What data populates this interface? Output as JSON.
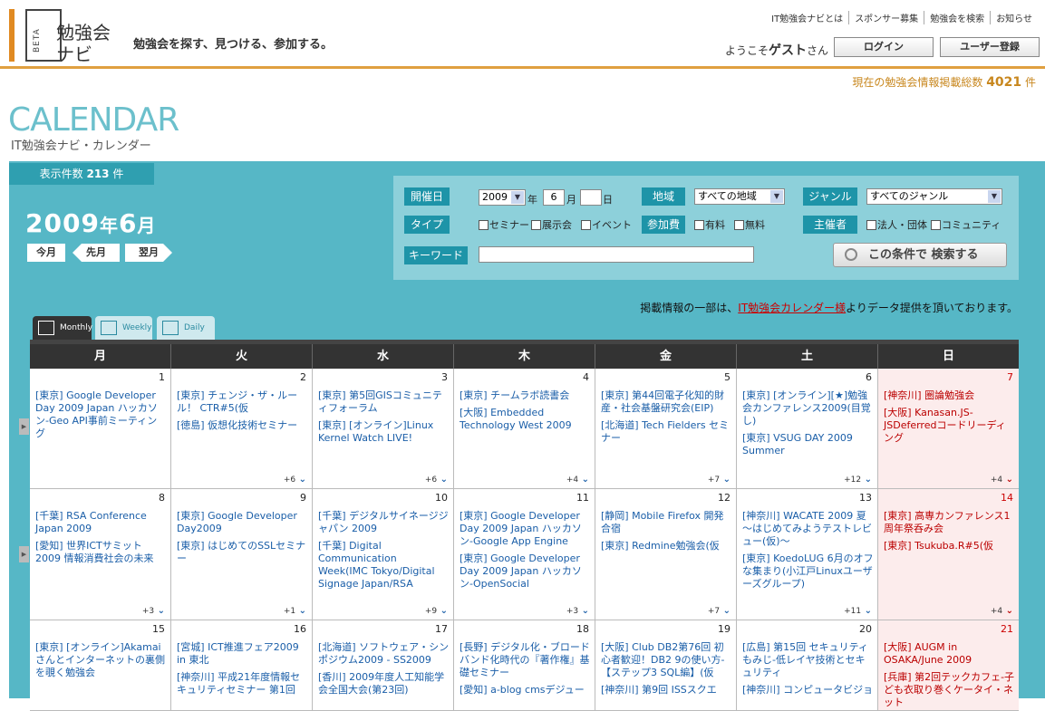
{
  "header": {
    "logo_beta": "BETA",
    "logo_name_1": "勉強会",
    "logo_name_2": "ナビ",
    "tagline": "勉強会を探す、見つける、参加する。",
    "nav": [
      "IT勉強会ナビとは",
      "スポンサー募集",
      "勉強会を検索",
      "お知らせ"
    ],
    "welcome_prefix": "ようこそ",
    "welcome_user": "ゲスト",
    "welcome_suffix": "さん",
    "login_label": "ログイン",
    "register_label": "ユーザー登録",
    "total_prefix": "現在の勉強会情報掲載総数",
    "total_count": "4021",
    "total_suffix": "件"
  },
  "title": {
    "main": "CALENDAR",
    "sub": "IT勉強会ナビ・カレンダー"
  },
  "count": {
    "prefix": "表示件数",
    "value": "213",
    "suffix": "件"
  },
  "current_month": {
    "year": "2009",
    "year_unit": "年",
    "month": "6",
    "month_unit": "月"
  },
  "month_nav": {
    "today": "今月",
    "prev": "先月",
    "next": "翌月"
  },
  "search": {
    "date_label": "開催日",
    "year_value": "2009",
    "year_unit": "年",
    "month_value": "6",
    "month_unit": "月",
    "day_value": "",
    "day_unit": "日",
    "region_label": "地域",
    "region_value": "すべての地域",
    "genre_label": "ジャンル",
    "genre_value": "すべてのジャンル",
    "type_label": "タイプ",
    "type_options": [
      "セミナー",
      "展示会",
      "イベント"
    ],
    "fee_label": "参加費",
    "fee_options": [
      "有料",
      "無料"
    ],
    "organizer_label": "主催者",
    "organizer_options": [
      "法人・団体",
      "コミュニティ"
    ],
    "keyword_label": "キーワード",
    "keyword_value": "",
    "submit_label": "この条件で 検索する"
  },
  "credit": {
    "prefix": "掲載情報の一部は、",
    "link": "IT勉強会カレンダー様",
    "suffix": "よりデータ提供を頂いております。"
  },
  "view_tabs": [
    "Monthly",
    "Weekly",
    "Daily"
  ],
  "colors": {
    "accent_orange": "#e08a22",
    "teal": "#56b7c6",
    "teal_dark": "#1e94a8",
    "link_blue": "#1a5ea8",
    "sunday_red": "#b00"
  },
  "weekdays": [
    "月",
    "火",
    "水",
    "木",
    "金",
    "土",
    "日"
  ],
  "weeks": [
    [
      {
        "day": "1",
        "events": [
          "[東京] Google Developer Day 2009 Japan ハッカソン-Geo API事前ミーティング"
        ],
        "more": ""
      },
      {
        "day": "2",
        "events": [
          "[東京] チェンジ・ザ・ルール！ CTR#5(仮",
          "[徳島] 仮想化技術セミナー"
        ],
        "more": "+6"
      },
      {
        "day": "3",
        "events": [
          "[東京] 第5回GISコミュニティフォーラム",
          "[東京] [オンライン]Linux Kernel Watch LIVE!"
        ],
        "more": "+6"
      },
      {
        "day": "4",
        "events": [
          "[東京] チームラボ読書会",
          "[大阪] Embedded Technology West 2009"
        ],
        "more": "+4"
      },
      {
        "day": "5",
        "events": [
          "[東京] 第44回電子化知的財産・社会基盤研究会(EIP)",
          "[北海道] Tech Fielders セミナー"
        ],
        "more": "+7"
      },
      {
        "day": "6",
        "events": [
          "[東京] [オンライン][★]勉強会カンファレンス2009(目覚し)",
          "[東京] VSUG DAY 2009 Summer"
        ],
        "more": "+12"
      },
      {
        "day": "7",
        "events": [
          "[神奈川] 圏論勉強会",
          "[大阪] Kanasan.JS-JSDeferredコードリーディング"
        ],
        "more": "+4"
      }
    ],
    [
      {
        "day": "8",
        "events": [
          "[千葉] RSA Conference Japan 2009",
          "[愛知] 世界ICTサミット2009 情報消費社会の未来"
        ],
        "more": "+3"
      },
      {
        "day": "9",
        "events": [
          "[東京] Google Developer Day2009",
          "[東京] はじめてのSSLセミナー"
        ],
        "more": "+1"
      },
      {
        "day": "10",
        "events": [
          "[千葉] デジタルサイネージジャパン 2009",
          "[千葉] Digital Communication Week(IMC Tokyo/Digital Signage Japan/RSA"
        ],
        "more": "+9"
      },
      {
        "day": "11",
        "events": [
          "[東京] Google Developer Day 2009 Japan ハッカソン-Google App Engine",
          "[東京] Google Developer Day 2009 Japan ハッカソン-OpenSocial"
        ],
        "more": "+3"
      },
      {
        "day": "12",
        "events": [
          "[静岡] Mobile Firefox 開発合宿",
          "[東京] Redmine勉強会(仮"
        ],
        "more": "+7"
      },
      {
        "day": "13",
        "events": [
          "[神奈川] WACATE 2009 夏 〜はじめてみようテストレビュー(仮)〜",
          "[東京] KoedoLUG 6月のオフな集まり(小江戸Linuxユーザーズグループ)"
        ],
        "more": "+11"
      },
      {
        "day": "14",
        "events": [
          "[東京] 高専カンファレンス1周年祭呑み会",
          "[東京] Tsukuba.R#5(仮"
        ],
        "more": "+4"
      }
    ],
    [
      {
        "day": "15",
        "events": [
          "[東京] [オンライン]Akamaiさんとインターネットの裏側を覗く勉強会"
        ],
        "more": ""
      },
      {
        "day": "16",
        "events": [
          "[宮城] ICT推進フェア2009 in 東北",
          "[神奈川] 平成21年度情報セキュリティセミナー 第1回"
        ],
        "more": ""
      },
      {
        "day": "17",
        "events": [
          "[北海道] ソフトウェア・シンポジウム2009 - SS2009",
          "[香川] 2009年度人工知能学会全国大会(第23回)"
        ],
        "more": ""
      },
      {
        "day": "18",
        "events": [
          "[長野] デジタル化・ブロードバンド化時代の『著作権』基礎セミナー",
          "[愛知] a-blog cmsデジュー"
        ],
        "more": ""
      },
      {
        "day": "19",
        "events": [
          "[大阪] Club DB2第76回 初心者歓迎！DB2 9の使い方-【ステップ3 SQL編】(仮",
          "[神奈川] 第9回 ISSスクエ"
        ],
        "more": ""
      },
      {
        "day": "20",
        "events": [
          "[広島] 第15回 セキュリティもみじ-低レイヤ技術とセキュリティ",
          "[神奈川] コンピュータビジョ"
        ],
        "more": ""
      },
      {
        "day": "21",
        "events": [
          "[大阪] AUGM in OSAKA/June 2009",
          "[兵庫] 第2回テックカフェ-子ども衣取り巻くケータイ・ネット"
        ],
        "more": ""
      }
    ]
  ]
}
